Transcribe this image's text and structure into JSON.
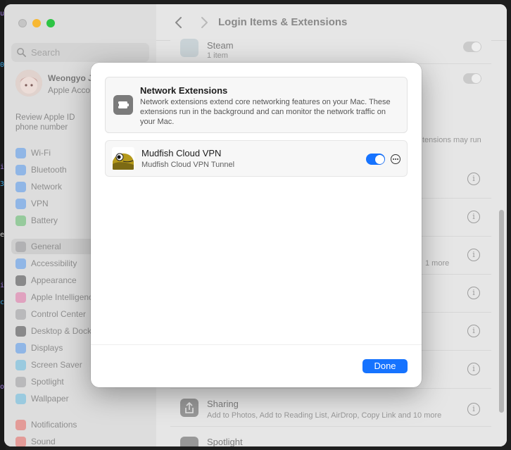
{
  "window": {
    "title": "Login Items & Extensions"
  },
  "sidebar": {
    "search_placeholder": "Search",
    "account_name": "Weongyo J",
    "account_sub": "Apple Acco",
    "review_text": "Review Apple ID phone number",
    "items": [
      {
        "label": "Wi-Fi",
        "color": "#2c84f7"
      },
      {
        "label": "Bluetooth",
        "color": "#2c84f7"
      },
      {
        "label": "Network",
        "color": "#2c84f7"
      },
      {
        "label": "VPN",
        "color": "#2c84f7"
      },
      {
        "label": "Battery",
        "color": "#3ab54a"
      },
      {
        "label": "General",
        "color": "#8e8e93"
      },
      {
        "label": "Accessibility",
        "color": "#2c84f7"
      },
      {
        "label": "Appearance",
        "color": "#1d1d1f"
      },
      {
        "label": "Apple Intelligence",
        "color": "#e8569c"
      },
      {
        "label": "Control Center",
        "color": "#8e8e93"
      },
      {
        "label": "Desktop & Dock",
        "color": "#1d1d1f"
      },
      {
        "label": "Displays",
        "color": "#2c84f7"
      },
      {
        "label": "Screen Saver",
        "color": "#45b5e6"
      },
      {
        "label": "Spotlight",
        "color": "#8e8e93"
      },
      {
        "label": "Wallpaper",
        "color": "#45b5e6"
      },
      {
        "label": "Notifications",
        "color": "#f0483e"
      },
      {
        "label": "Sound",
        "color": "#f0483e"
      }
    ]
  },
  "background": {
    "steam_title": "Steam",
    "steam_sub": "1 item",
    "partial_text": "tensions may run",
    "one_more": "1 more",
    "sharing_title": "Sharing",
    "sharing_sub": "Add to Photos, Add to Reading List, AirDrop, Copy Link and 10 more",
    "spotlight_title": "Spotlight"
  },
  "sheet": {
    "title": "Network Extensions",
    "description": "Network extensions extend core networking features on your Mac. These extensions run in the background and can monitor the network traffic on your Mac.",
    "extension": {
      "name": "Mudfish Cloud VPN",
      "subtitle": "Mudfish Cloud VPN Tunnel",
      "enabled": true
    },
    "done_label": "Done"
  },
  "colors": {
    "accent": "#1673ff"
  }
}
